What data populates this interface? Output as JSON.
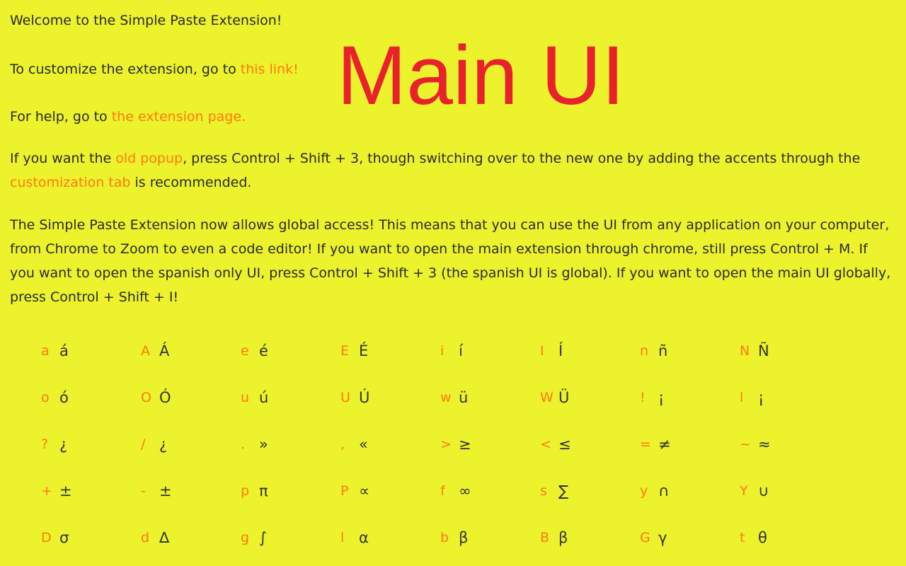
{
  "intro": {
    "welcome": "Welcome to the Simple Paste Extension!",
    "customize_prefix": "To customize the extension, go to ",
    "customize_link": "this link!",
    "help_prefix": "For help, go to ",
    "help_link": "the extension page.",
    "old_prefix": "If you want the ",
    "old_link": "old popup",
    "old_mid": ", press Control + Shift + 3, though switching over to the new one by adding the accents through the ",
    "old_link2": "customization tab",
    "old_suffix": " is recommended.",
    "global_text": "The Simple Paste Extension now allows global access! This means that you can use the UI from any application on your computer, from Chrome to Zoom to even a code editor! If you want to open the main extension through chrome, still press Control + M. If you want to open the spanish only UI, press Control + Shift + 3 (the spanish UI is global). If you want to open the main UI globally, press Control + Shift + I!"
  },
  "overlay_title": "Main UI",
  "colors": {
    "background": "#ecf22b",
    "link": "#ff7a14",
    "overlay": "#e8212d"
  },
  "shortcuts": [
    [
      {
        "key": "a",
        "char": "á"
      },
      {
        "key": "A",
        "char": "Á"
      },
      {
        "key": "e",
        "char": "é"
      },
      {
        "key": "E",
        "char": "É"
      },
      {
        "key": "i",
        "char": "í"
      },
      {
        "key": "I",
        "char": "Í"
      },
      {
        "key": "n",
        "char": "ñ"
      },
      {
        "key": "N",
        "char": "Ñ"
      }
    ],
    [
      {
        "key": "o",
        "char": "ó"
      },
      {
        "key": "O",
        "char": "Ó"
      },
      {
        "key": "u",
        "char": "ú"
      },
      {
        "key": "U",
        "char": "Ú"
      },
      {
        "key": "w",
        "char": "ü"
      },
      {
        "key": "W",
        "char": "Ü"
      },
      {
        "key": "!",
        "char": "¡"
      },
      {
        "key": "l",
        "char": "¡"
      }
    ],
    [
      {
        "key": "?",
        "char": "¿"
      },
      {
        "key": "/",
        "char": "¿"
      },
      {
        "key": ".",
        "char": "»"
      },
      {
        "key": ",",
        "char": "«"
      },
      {
        "key": ">",
        "char": "≥"
      },
      {
        "key": "<",
        "char": "≤"
      },
      {
        "key": "=",
        "char": "≠"
      },
      {
        "key": "~",
        "char": "≈"
      }
    ],
    [
      {
        "key": "+",
        "char": "±"
      },
      {
        "key": "-",
        "char": "±"
      },
      {
        "key": "p",
        "char": "π"
      },
      {
        "key": "P",
        "char": "∝"
      },
      {
        "key": "f",
        "char": "∞"
      },
      {
        "key": "s",
        "char": "∑"
      },
      {
        "key": "y",
        "char": "∩"
      },
      {
        "key": "Y",
        "char": "∪"
      }
    ],
    [
      {
        "key": "D",
        "char": "σ"
      },
      {
        "key": "d",
        "char": "∆"
      },
      {
        "key": "g",
        "char": "∫"
      },
      {
        "key": "l",
        "char": "α"
      },
      {
        "key": "b",
        "char": "β"
      },
      {
        "key": "B",
        "char": "β"
      },
      {
        "key": "G",
        "char": "γ"
      },
      {
        "key": "t",
        "char": "θ"
      }
    ]
  ]
}
